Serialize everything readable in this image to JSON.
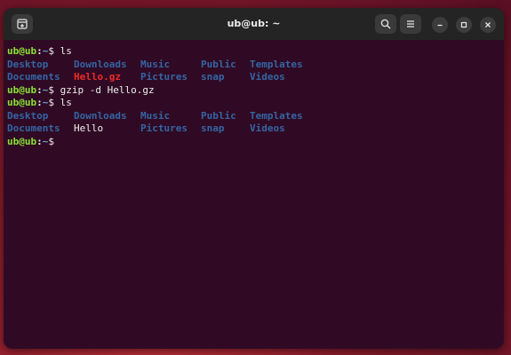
{
  "window": {
    "title": "ub@ub: ~"
  },
  "icons": {
    "new_tab": "new-tab-icon",
    "search": "search-icon",
    "menu": "hamburger-menu-icon",
    "minimize": "minimize-icon",
    "maximize": "maximize-icon",
    "close": "close-icon"
  },
  "colors": {
    "terminal_bg": "#300a24",
    "prompt_user": "#8ae234",
    "prompt_path": "#729fcf",
    "directory": "#3465a4",
    "archive": "#ef2929",
    "text": "#eeeeec"
  },
  "terminal": {
    "prompt": {
      "user": "ub@ub",
      "sep": ":",
      "path": "~",
      "dollar": "$"
    },
    "commands": {
      "c1": " ls",
      "c2": " gzip -d Hello.gz",
      "c3": " ls"
    },
    "ls1": {
      "row1": [
        "Desktop",
        "Downloads",
        "Music",
        "Public",
        "Templates"
      ],
      "row2": [
        "Documents",
        "Hello.gz",
        "Pictures",
        "snap",
        "Videos"
      ]
    },
    "ls2": {
      "row1": [
        "Desktop",
        "Downloads",
        "Music",
        "Public",
        "Templates"
      ],
      "row2": [
        "Documents",
        "Hello",
        "Pictures",
        "snap",
        "Videos"
      ]
    }
  }
}
